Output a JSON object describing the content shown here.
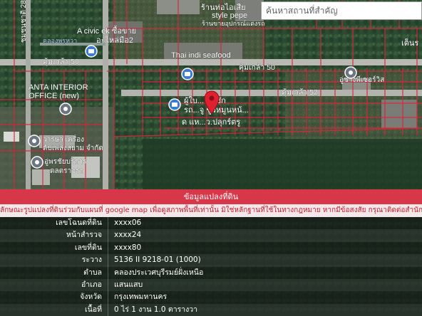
{
  "search": {
    "placeholder": "ค้นหาสถานที่สำคัญ"
  },
  "map_labels": {
    "shop_top": "ร้านท่อไอเสีย",
    "style_pepe": "style pepe",
    "shop_top2": "ร้านขายอุปกรณ์แต่งรถ",
    "civic": "A civic ek ซื้อขาย",
    "civic2": "อะไหล่มือ2",
    "canal": "คลองพรูหวา",
    "thai_indi": "Thai indi seafood",
    "soi50": "คุ้มเกล้า 50",
    "soi50b": "คุ้มเกล้า 50",
    "soi52": "คุ้มเกล้า 52",
    "anta1": "ANTA INTERIOR",
    "anta2": "OFFICE (new)",
    "center1": "ผู้ใบ...จ ดชัก",
    "center2": "รถ...จู ชูวหมูนหน้...",
    "center3": "ด แห...ว.ปลุกร์ตรู",
    "north_right": "เต็นร",
    "pharmacy": "อู่ชางพีเซอร์วิส",
    "factory1": "วาริษา เครื่อง",
    "factory2": "ดับเพลิงสยาม จำกัด",
    "garage1": "อู่พรชัยบริการ",
    "garage2": "ดลตราจรถ",
    "left_vert": "ชุมชนชาติ 28"
  },
  "panel": {
    "title": "ข้อมูลแปลงที่ดิน",
    "notice": "ลักษณะรูปแปลงที่ดินร่วมกับแผนที่ google map เพื่อดูสภาพพื้นที่เท่านั้น มิใช่หลักฐานที่ใช้ในทางกฎหมาย หากมีข้อสงสัย กรุณาติดต่อสำนักงานที่ดิน",
    "rows": [
      {
        "label": "เลขโฉนดที่ดิน",
        "value": "xxxx06"
      },
      {
        "label": "หน้าสำรวจ",
        "value": "xxxx24"
      },
      {
        "label": "เลขที่ดิน",
        "value": "xxxx80"
      },
      {
        "label": "ระวาง",
        "value": "5136 II 9218-01 (1000)"
      },
      {
        "label": "ตำบล",
        "value": "คลองประเวศบุรีรมย์ฝั่งเหนือ"
      },
      {
        "label": "อำเภอ",
        "value": "แสนแสบ"
      },
      {
        "label": "จังหวัด",
        "value": "กรุงเทพมหานคร"
      },
      {
        "label": "เนื้อที่",
        "value": "0 ไร่ 1 งาน 1.0 ตารางวา"
      }
    ]
  },
  "colors": {
    "parcel": "#d8263c",
    "pin": "#e0202e",
    "header": "#d8374a",
    "poi_blue": "#3a7bd5"
  }
}
